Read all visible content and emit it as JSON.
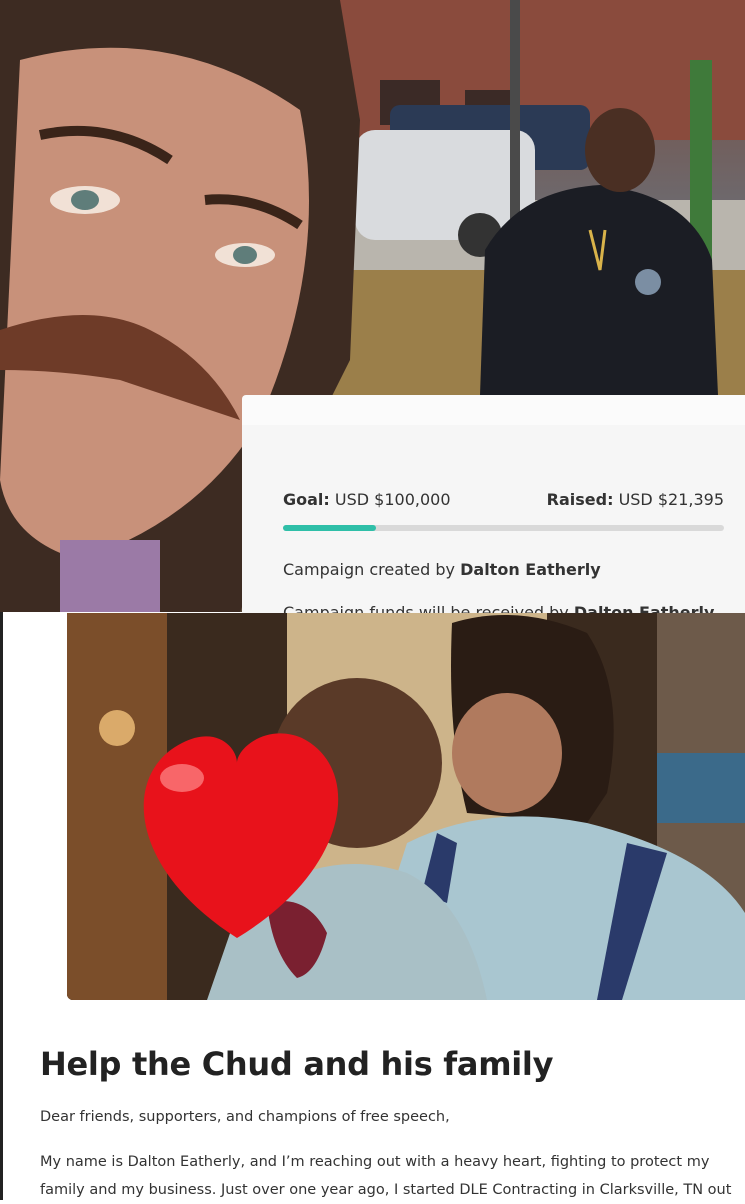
{
  "campaign": {
    "goal_label": "Goal:",
    "goal_value": "USD $100,000",
    "raised_label": "Raised:",
    "raised_value": "USD $21,395",
    "progress_fraction": 0.21,
    "created_prefix": "Campaign created by",
    "created_name": "Dalton Eatherly",
    "funds_prefix": "Campaign funds will be received by",
    "funds_name": "Dalton Eatherly"
  },
  "story": {
    "title": "Help the Chud and his family",
    "greeting": "Dear friends, supporters, and champions of free speech,",
    "paragraph": "My name is Dalton Eatherly, and I’m reaching out with a heavy heart, fighting to protect my family and my business. Just over one year ago, I started DLE Contracting in Clarksville, TN out"
  },
  "colors": {
    "progress_fill": "#2fbfa8",
    "progress_track": "#d9d9d9",
    "heart": "#e8121b"
  },
  "icons": {
    "heart": "heart-emoji-icon"
  }
}
